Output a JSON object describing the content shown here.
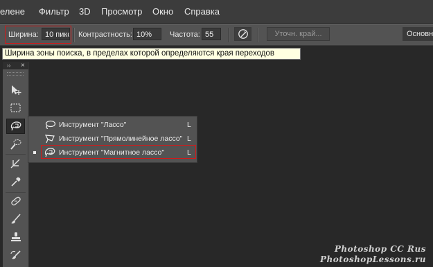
{
  "menubar": {
    "items": [
      "елене",
      "Фильтр",
      "3D",
      "Просмотр",
      "Окно",
      "Справка"
    ]
  },
  "options": {
    "width_label": "Ширина:",
    "width_value": "10 пикс",
    "contrast_label": "Контрастность:",
    "contrast_value": "10%",
    "frequency_label": "Частота:",
    "frequency_value": "55",
    "refine_edge_label": "Уточн. край...",
    "workspace_label": "Основна"
  },
  "tooltip": {
    "text": "Ширина зоны поиска, в пределах которой определяются края переходов"
  },
  "toolbar": {
    "collapse_label": "››",
    "close_label": "×"
  },
  "flyout": {
    "items": [
      {
        "label": "Инструмент \"Лассо\"",
        "shortcut": "L",
        "icon": "lasso-icon",
        "selected": false
      },
      {
        "label": "Инструмент \"Прямолинейное лассо\"",
        "shortcut": "L",
        "icon": "polygonal-lasso-icon",
        "selected": false
      },
      {
        "label": "Инструмент \"Магнитное лассо\"",
        "shortcut": "L",
        "icon": "magnetic-lasso-icon",
        "selected": true
      }
    ]
  },
  "watermark": {
    "line1": "Photoshop CC Rus",
    "line2": "PhotoshopLessons.ru"
  },
  "colors": {
    "highlight": "#d11a1a",
    "tooltip_bg": "#ffffe1",
    "panel": "#535353",
    "canvas": "#282828"
  }
}
